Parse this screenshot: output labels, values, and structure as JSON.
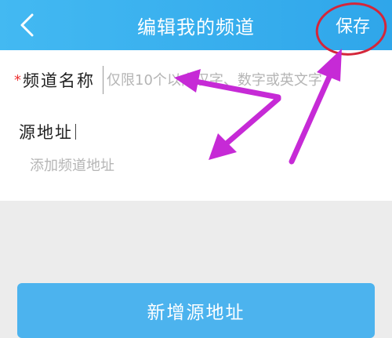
{
  "header": {
    "title": "编辑我的频道",
    "save_label": "保存"
  },
  "form": {
    "channel_name": {
      "required_mark": "*",
      "label": "频道名称",
      "value": "",
      "placeholder": "仅限10个以内汉字、数字或英文字"
    },
    "source_address": {
      "label": "源地址",
      "value": "",
      "placeholder": "添加频道地址"
    }
  },
  "actions": {
    "add_source_label": "新增源地址"
  },
  "colors": {
    "header": "#2fa6ea",
    "button": "#4cb3ee",
    "annotation": "#c62ad6",
    "highlight_circle": "#d4263a"
  }
}
